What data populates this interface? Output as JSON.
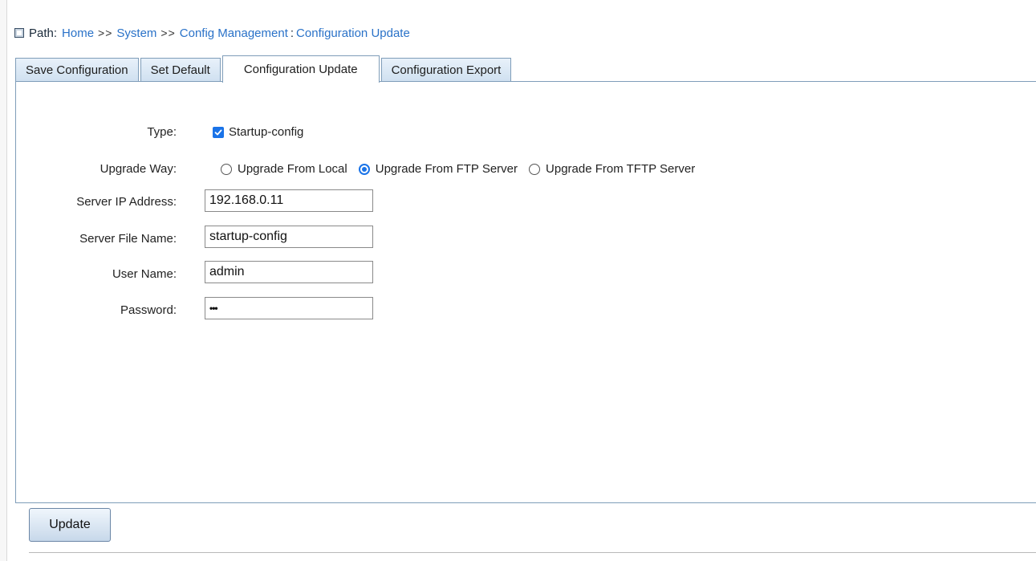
{
  "breadcrumb": {
    "label": "Path:",
    "items": [
      "Home",
      "System",
      "Config Management"
    ],
    "separator": ">>",
    "current": "Configuration Update"
  },
  "tabs": [
    {
      "label": "Save Configuration",
      "active": false
    },
    {
      "label": "Set Default",
      "active": false
    },
    {
      "label": "Configuration Update",
      "active": true
    },
    {
      "label": "Configuration Export",
      "active": false
    }
  ],
  "form": {
    "type": {
      "label": "Type:",
      "checkbox_label": "Startup-config",
      "checked": true
    },
    "upgrade_way": {
      "label": "Upgrade Way:",
      "options": [
        {
          "label": "Upgrade From Local",
          "checked": false
        },
        {
          "label": "Upgrade From FTP Server",
          "checked": true
        },
        {
          "label": "Upgrade From TFTP Server",
          "checked": false
        }
      ]
    },
    "server_ip": {
      "label": "Server IP Address:",
      "value": "192.168.0.11"
    },
    "server_file": {
      "label": "Server File Name:",
      "value": "startup-config"
    },
    "user_name": {
      "label": "User Name:",
      "value": "admin"
    },
    "password": {
      "label": "Password:",
      "value": "•••"
    }
  },
  "actions": {
    "update_label": "Update"
  },
  "colors": {
    "link": "#2a72c8",
    "accent": "#1a73e8",
    "tab_border": "#7f9db9"
  }
}
